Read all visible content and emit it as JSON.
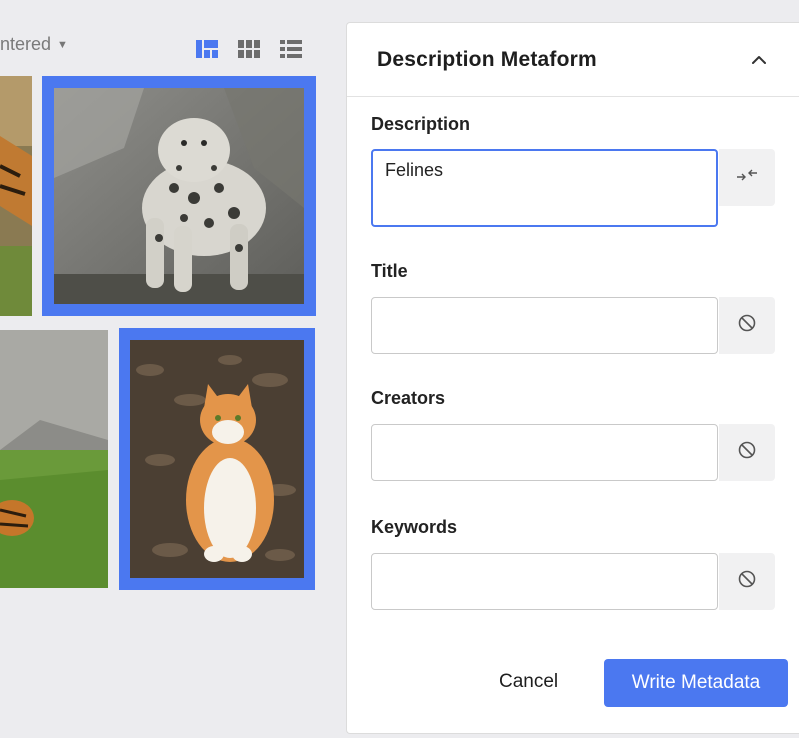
{
  "gallery": {
    "sort_label": "ntered",
    "view_modes": [
      "masonry-view-icon",
      "grid-view-icon",
      "list-view-icon"
    ],
    "photos": [
      {
        "name": "snow-leopard-photo",
        "selected": true
      },
      {
        "name": "tiger-photo-partial",
        "selected": false
      },
      {
        "name": "tiger-grass-photo-partial",
        "selected": false
      },
      {
        "name": "orange-white-cat-photo",
        "selected": true
      }
    ]
  },
  "panel": {
    "title": "Description Metaform",
    "fields": {
      "description": {
        "label": "Description",
        "value": "Felines"
      },
      "title": {
        "label": "Title",
        "value": ""
      },
      "creators": {
        "label": "Creators",
        "value": ""
      },
      "keywords": {
        "label": "Keywords",
        "value": ""
      }
    },
    "cancel_label": "Cancel",
    "submit_label": "Write Metadata"
  },
  "colors": {
    "accent": "#4b78f0",
    "background": "#ececef",
    "panel": "#ffffff"
  }
}
